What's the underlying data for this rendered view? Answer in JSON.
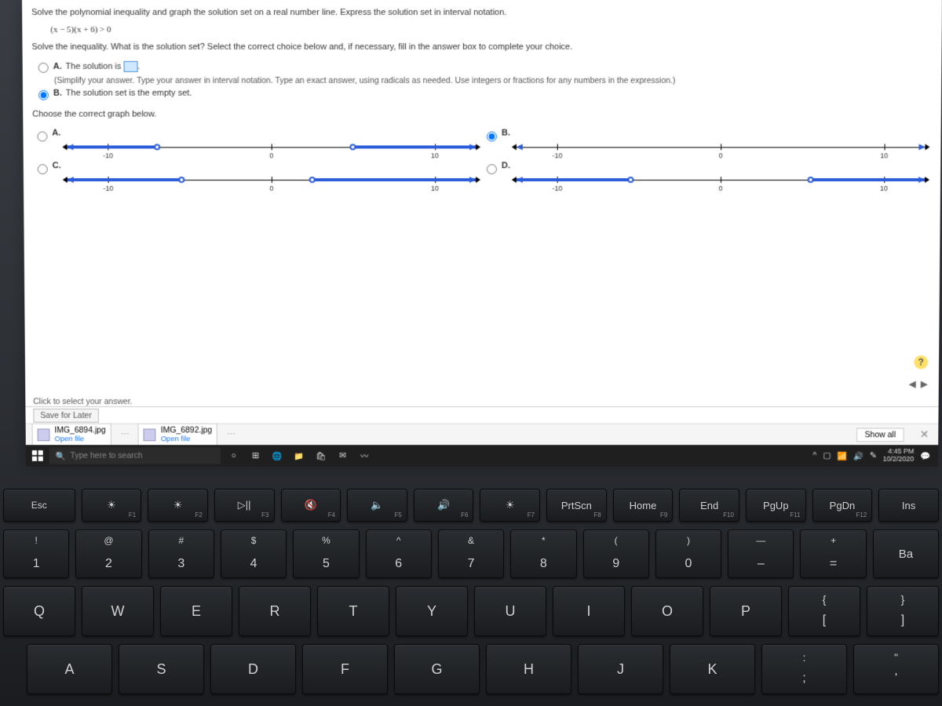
{
  "quiz": {
    "question": "Solve the polynomial inequality and graph the solution set on a real number line. Express the solution set in interval notation.",
    "expression": "(x − 5)(x + 6) > 0",
    "instruction": "Solve the inequality. What is the solution set? Select the correct choice below and, if necessary, fill in the answer box to complete your choice.",
    "choice_a_label": "A.",
    "choice_a_text": "The solution is",
    "choice_a_hint": "(Simplify your answer. Type your answer in interval notation. Type an exact answer, using radicals as needed. Use integers or fractions for any numbers in the expression.)",
    "choice_b_label": "B.",
    "choice_b_text": "The solution set is the empty set.",
    "graph_prompt": "Choose the correct graph below.",
    "tick_neg10": "-10",
    "tick_0": "0",
    "tick_10": "10",
    "opt_a": "A.",
    "opt_b": "B.",
    "opt_c": "C.",
    "opt_d": "D.",
    "click_hint": "Click to select your answer.",
    "save_later": "Save for Later"
  },
  "downloads": {
    "file1": "IMG_6894.jpg",
    "file2": "IMG_6892.jpg",
    "open": "Open file",
    "show_all": "Show all"
  },
  "taskbar": {
    "search": "Type here to search",
    "time": "4:45 PM",
    "date": "10/2/2020"
  },
  "keyboard": {
    "esc": "Esc",
    "fn": [
      {
        "sym": "☀",
        "lbl": "F1"
      },
      {
        "sym": "☀",
        "lbl": "F2"
      },
      {
        "sym": "▷||",
        "lbl": "F3"
      },
      {
        "sym": "🔇",
        "lbl": "F4"
      },
      {
        "sym": "🔈",
        "lbl": "F5"
      },
      {
        "sym": "🔊",
        "lbl": "F6"
      },
      {
        "sym": "☀",
        "lbl": "F7"
      },
      {
        "sym": "PrtScn",
        "lbl": "F8"
      },
      {
        "sym": "Home",
        "lbl": "F9"
      },
      {
        "sym": "End",
        "lbl": "F10"
      },
      {
        "sym": "PgUp",
        "lbl": "F11"
      },
      {
        "sym": "PgDn",
        "lbl": "F12"
      },
      {
        "sym": "Ins",
        "lbl": ""
      }
    ],
    "num": [
      {
        "s": "!",
        "m": "1"
      },
      {
        "s": "@",
        "m": "2"
      },
      {
        "s": "#",
        "m": "3"
      },
      {
        "s": "$",
        "m": "4"
      },
      {
        "s": "%",
        "m": "5"
      },
      {
        "s": "^",
        "m": "6"
      },
      {
        "s": "&",
        "m": "7"
      },
      {
        "s": "*",
        "m": "8"
      },
      {
        "s": "(",
        "m": "9"
      },
      {
        "s": ")",
        "m": "0"
      },
      {
        "s": "—",
        "m": "–"
      },
      {
        "s": "+",
        "m": "="
      }
    ],
    "row1": [
      "Q",
      "W",
      "E",
      "R",
      "T",
      "Y",
      "U",
      "I",
      "O",
      "P"
    ],
    "brackets": [
      {
        "s": "{",
        "m": "["
      },
      {
        "s": "}",
        "m": "]"
      }
    ],
    "row2": [
      "A",
      "S",
      "D",
      "F",
      "G",
      "H",
      "J",
      "K"
    ],
    "row2_end": [
      {
        "s": ":",
        "m": ";"
      },
      {
        "s": "\"",
        "m": "'"
      }
    ]
  }
}
